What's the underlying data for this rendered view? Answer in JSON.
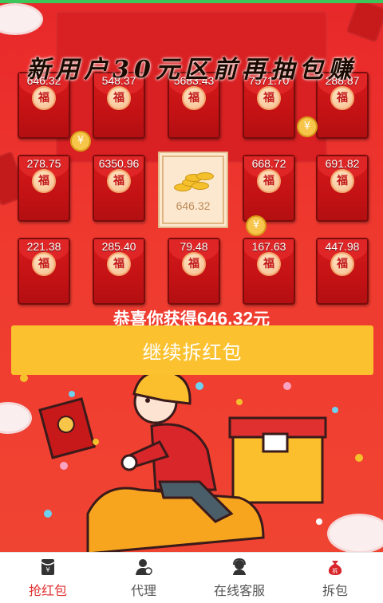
{
  "banner": {
    "title": "新用户30元区前再抽包赚"
  },
  "packets": [
    {
      "amount": "646.32",
      "fu": "福"
    },
    {
      "amount": "548.37",
      "fu": "福"
    },
    {
      "amount": "5683.43",
      "fu": "福"
    },
    {
      "amount": "7571.70",
      "fu": "福"
    },
    {
      "amount": "288.87",
      "fu": "福"
    },
    {
      "amount": "278.75",
      "fu": "福"
    },
    {
      "amount": "6350.96",
      "fu": "福"
    },
    {
      "amount": "646.32",
      "opened": true
    },
    {
      "amount": "668.72",
      "fu": "福"
    },
    {
      "amount": "691.82",
      "fu": "福"
    },
    {
      "amount": "221.38",
      "fu": "福"
    },
    {
      "amount": "285.40",
      "fu": "福"
    },
    {
      "amount": "79.48",
      "fu": "福"
    },
    {
      "amount": "167.63",
      "fu": "福"
    },
    {
      "amount": "447.98",
      "fu": "福"
    }
  ],
  "result": {
    "prefix": "恭喜你获得",
    "amount": "646.32",
    "suffix": "元"
  },
  "continue_button": {
    "label": "继续拆红包"
  },
  "float_coin_symbol": "¥",
  "nav": {
    "items": [
      {
        "label": "抢红包",
        "icon": "red-envelope-icon",
        "active": true
      },
      {
        "label": "代理",
        "icon": "agent-icon",
        "active": false
      },
      {
        "label": "在线客服",
        "icon": "headset-icon",
        "active": false
      },
      {
        "label": "拆包",
        "icon": "money-bag-icon",
        "active": false
      }
    ]
  },
  "colors": {
    "accent": "#e0302f",
    "button": "#fbc12f",
    "background": "#e8282a",
    "top_strip": "#3cc65a"
  }
}
